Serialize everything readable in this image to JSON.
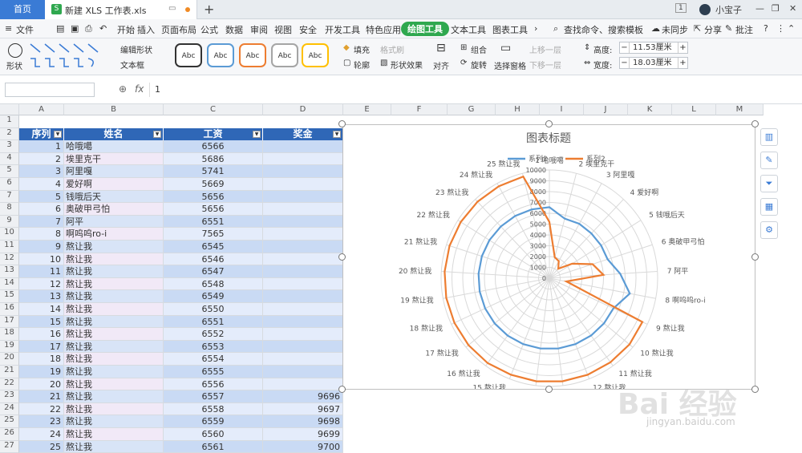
{
  "tabbar": {
    "home": "首页",
    "doc_title": "新建 XLS 工作表.xls",
    "tab_badge": "1",
    "user": "小宝子"
  },
  "menu": {
    "file": "文件",
    "items": [
      "开始",
      "插入",
      "页面布局",
      "公式",
      "数据",
      "审阅",
      "视图",
      "安全",
      "开发工具",
      "特色应用",
      "绘图工具",
      "文本工具",
      "图表工具"
    ],
    "active_index": 10,
    "search": "查找命令、搜索模板",
    "sync": "未同步",
    "share": "分享",
    "comment": "批注",
    "help": "?"
  },
  "ribbon": {
    "shape_label": "形状",
    "edit_shape": "编辑形状",
    "text_box": "文本框",
    "style_label": "Abc",
    "fill": "填充",
    "format_brush": "格式刷",
    "outline": "轮廓",
    "shape_effect": "形状效果",
    "align": "对齐",
    "group": "组合",
    "rotate": "旋转",
    "select_pane": "选择窗格",
    "up_layer": "上移一层",
    "down_layer": "下移一层",
    "height_label": "高度:",
    "height_value": "11.53厘米",
    "width_label": "宽度:",
    "width_value": "18.03厘米"
  },
  "formula": {
    "name_box": "",
    "fx": "fx",
    "value": "1"
  },
  "columns": [
    "A",
    "B",
    "C",
    "D",
    "E",
    "F",
    "G",
    "H",
    "I",
    "J",
    "K",
    "L",
    "M"
  ],
  "table": {
    "headers": [
      "序列",
      "姓名",
      "工资",
      "奖金"
    ],
    "rows": [
      {
        "r": "3",
        "a": "1",
        "b": "哈哦噶",
        "c": "6566",
        "d": ""
      },
      {
        "r": "4",
        "a": "2",
        "b": "埃里克干",
        "c": "5686",
        "d": ""
      },
      {
        "r": "5",
        "a": "3",
        "b": "阿里嘎",
        "c": "5741",
        "d": ""
      },
      {
        "r": "6",
        "a": "4",
        "b": "爱好啊",
        "c": "5669",
        "d": ""
      },
      {
        "r": "7",
        "a": "5",
        "b": "钱哦后天",
        "c": "5656",
        "d": ""
      },
      {
        "r": "8",
        "a": "6",
        "b": "奥破甲弓怕",
        "c": "5656",
        "d": ""
      },
      {
        "r": "9",
        "a": "7",
        "b": "阿平",
        "c": "6551",
        "d": ""
      },
      {
        "r": "10",
        "a": "8",
        "b": "啊呜呜ro-i",
        "c": "7565",
        "d": ""
      },
      {
        "r": "11",
        "a": "9",
        "b": "熬让我",
        "c": "6545",
        "d": ""
      },
      {
        "r": "12",
        "a": "10",
        "b": "熬让我",
        "c": "6546",
        "d": ""
      },
      {
        "r": "13",
        "a": "11",
        "b": "熬让我",
        "c": "6547",
        "d": ""
      },
      {
        "r": "14",
        "a": "12",
        "b": "熬让我",
        "c": "6548",
        "d": ""
      },
      {
        "r": "15",
        "a": "13",
        "b": "熬让我",
        "c": "6549",
        "d": ""
      },
      {
        "r": "16",
        "a": "14",
        "b": "熬让我",
        "c": "6550",
        "d": ""
      },
      {
        "r": "17",
        "a": "15",
        "b": "熬让我",
        "c": "6551",
        "d": ""
      },
      {
        "r": "18",
        "a": "16",
        "b": "熬让我",
        "c": "6552",
        "d": ""
      },
      {
        "r": "19",
        "a": "17",
        "b": "熬让我",
        "c": "6553",
        "d": ""
      },
      {
        "r": "20",
        "a": "18",
        "b": "熬让我",
        "c": "6554",
        "d": ""
      },
      {
        "r": "21",
        "a": "19",
        "b": "熬让我",
        "c": "6555",
        "d": ""
      },
      {
        "r": "22",
        "a": "20",
        "b": "熬让我",
        "c": "6556",
        "d": ""
      },
      {
        "r": "23",
        "a": "21",
        "b": "熬让我",
        "c": "6557",
        "d": "9696"
      },
      {
        "r": "24",
        "a": "22",
        "b": "熬让我",
        "c": "6558",
        "d": "9697"
      },
      {
        "r": "25",
        "a": "23",
        "b": "熬让我",
        "c": "6559",
        "d": "9698"
      },
      {
        "r": "26",
        "a": "24",
        "b": "熬让我",
        "c": "6560",
        "d": "9699"
      },
      {
        "r": "27",
        "a": "25",
        "b": "熬让我",
        "c": "6561",
        "d": "9700"
      }
    ]
  },
  "chart_data": {
    "type": "radar",
    "title": "图表标题",
    "legend_position": "top",
    "categories": [
      "1 哈哦噶",
      "2 埃里克干",
      "3 阿里嘎",
      "4 爱好啊",
      "5 钱哦后天",
      "6 奥破甲弓怕",
      "7 阿平",
      "8 啊呜呜ro-i",
      "9 熬让我",
      "10 熬让我",
      "11 熬让我",
      "12 熬让我",
      "13 熬让我",
      "14 熬让我",
      "15 熬让我",
      "16 熬让我",
      "17 熬让我",
      "18 熬让我",
      "19 熬让我",
      "20 熬让我",
      "21 熬让我",
      "22 熬让我",
      "23 熬让我",
      "24 熬让我",
      "25 熬让我"
    ],
    "ticks": [
      "0",
      "1000",
      "2000",
      "3000",
      "4000",
      "5000",
      "6000",
      "7000",
      "8000",
      "9000",
      "10000"
    ],
    "rmax": 10000,
    "series": [
      {
        "name": "系列1",
        "color": "#5b9bd5",
        "values": [
          6566,
          5686,
          5741,
          5669,
          5656,
          5656,
          6551,
          7565,
          6545,
          6546,
          6547,
          6548,
          6549,
          6550,
          6551,
          6552,
          6553,
          6554,
          6555,
          6556,
          6557,
          6558,
          6559,
          6560,
          6561
        ]
      },
      {
        "name": "系列2",
        "color": "#ed7d31",
        "values": [
          5200,
          2000,
          1800,
          1200,
          2500,
          4200,
          5000,
          1600,
          9500,
          9600,
          9600,
          9600,
          9600,
          9600,
          9600,
          9696,
          9696,
          9696,
          9696,
          9696,
          9696,
          9697,
          9698,
          9699,
          9700
        ]
      }
    ]
  },
  "watermark": {
    "text": "Bai 经验",
    "url": "jingyan.baidu.com"
  }
}
